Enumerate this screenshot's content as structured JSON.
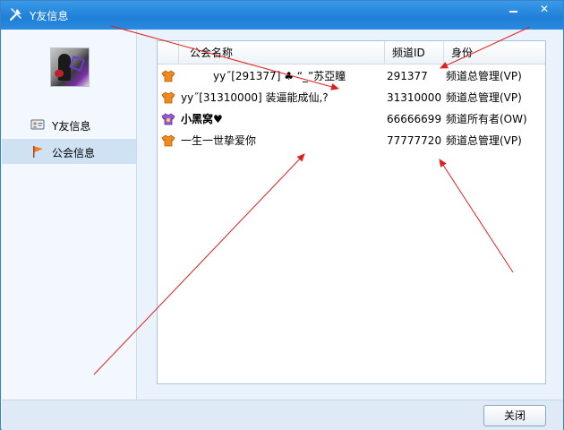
{
  "window": {
    "title": "Y友信息"
  },
  "titlebar": {
    "minimize_label": "—",
    "close_label": "✕"
  },
  "icons": {
    "title": "tools-icon",
    "friend_info": "id-card-icon",
    "guild_info": "flag-icon",
    "row_admin": "orange-shirt-icon",
    "row_owner": "purple-shirt-icon"
  },
  "colors": {
    "titlebar": "#1f7fd6",
    "selected_nav": "#cfe2f3",
    "annotation_arrow": "#e02020",
    "shirt_orange": "#f08a1c",
    "shirt_purple": "#9a5ad8"
  },
  "sidebar": {
    "items": [
      {
        "label": "Y友信息"
      },
      {
        "label": "公会信息"
      }
    ],
    "selected": "公会信息"
  },
  "table": {
    "columns": [
      "公会名称",
      "频道ID",
      "身份"
    ],
    "rows": [
      {
        "name": "yy˝[291377]  ♣ “_”苏亞瞳",
        "id": "291377",
        "role": "频道总管理(VP)",
        "icon": "orange-shirt-icon",
        "bold": false
      },
      {
        "name": "yy˝[31310000]  装逼能成仙,?",
        "id": "31310000",
        "role": "频道总管理(VP)",
        "icon": "orange-shirt-icon",
        "bold": false
      },
      {
        "name": "小黑窝♥",
        "id": "66666699",
        "role": "频道所有者(OW)",
        "icon": "purple-shirt-icon",
        "bold": true
      },
      {
        "name": "一生一世挚爱你",
        "id": "77777720",
        "role": "频道总管理(VP)",
        "icon": "orange-shirt-icon",
        "bold": false
      }
    ]
  },
  "footer": {
    "close_label": "关闭"
  }
}
